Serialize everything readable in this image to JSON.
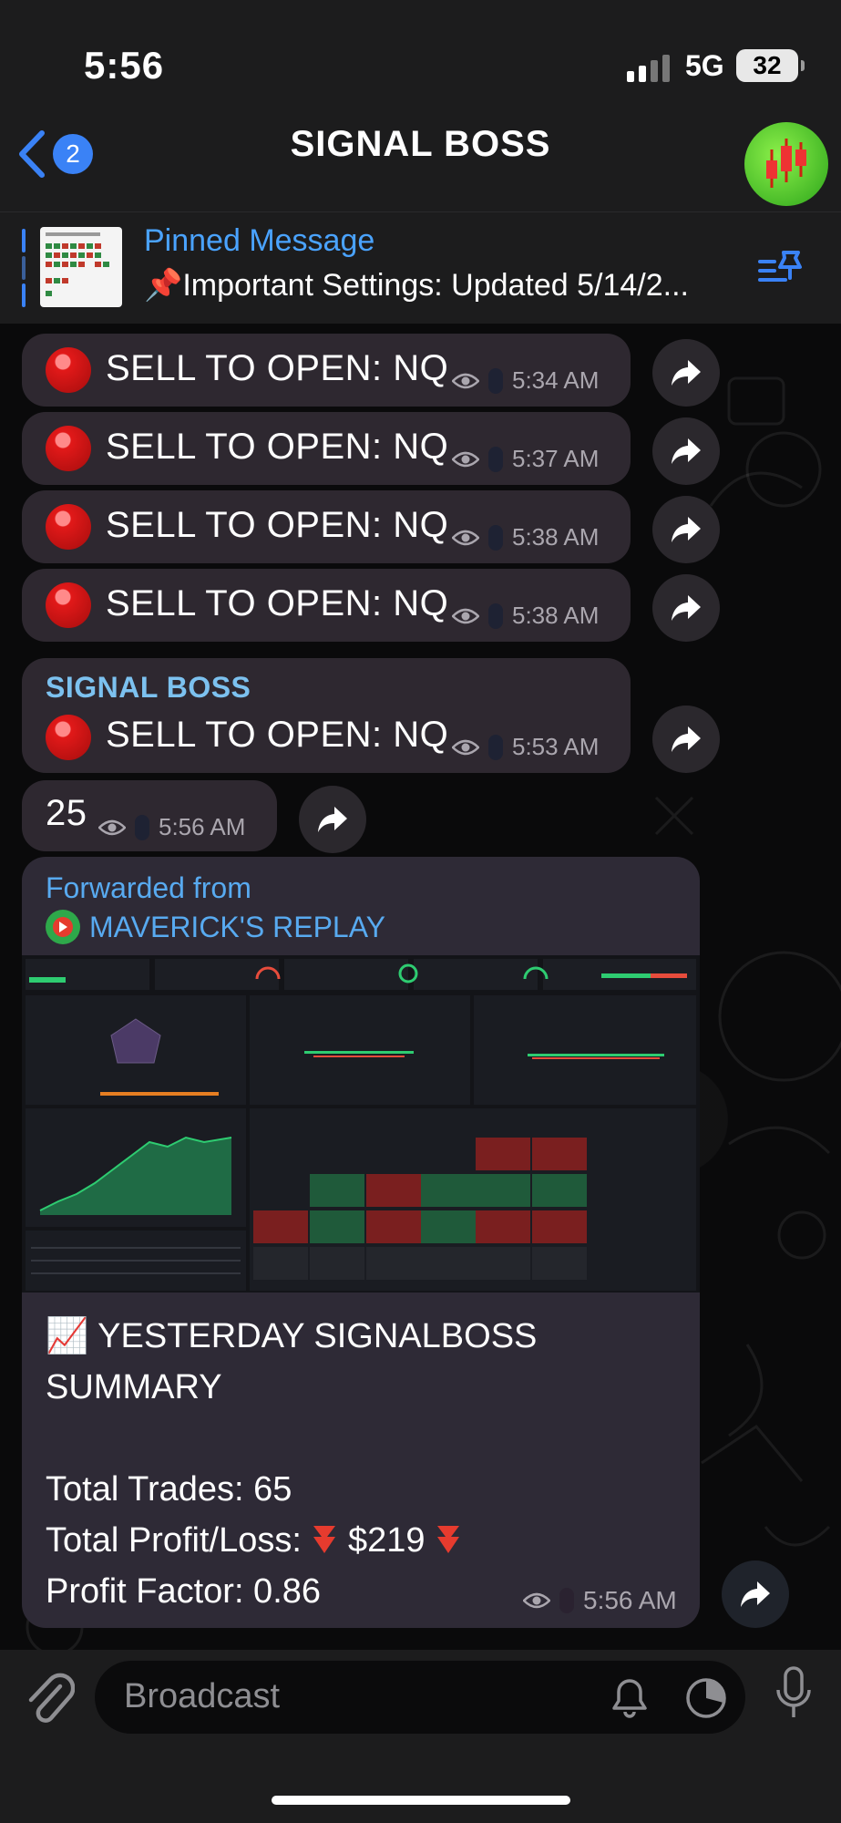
{
  "status": {
    "time": "5:56",
    "network": "5G",
    "battery": "32"
  },
  "header": {
    "back_count": "2",
    "title": "SIGNAL BOSS"
  },
  "pinned": {
    "label": "Pinned Message",
    "text": "📌Important Settings: Updated 5/14/2..."
  },
  "messages": [
    {
      "text": "SELL TO OPEN: NQ",
      "time": "5:34 AM"
    },
    {
      "text": "SELL TO OPEN: NQ",
      "time": "5:37 AM"
    },
    {
      "text": "SELL TO OPEN: NQ",
      "time": "5:38 AM"
    },
    {
      "text": "SELL TO OPEN: NQ",
      "time": "5:38 AM"
    },
    {
      "sender": "SIGNAL BOSS",
      "text": "SELL TO OPEN: NQ",
      "time": "5:53 AM"
    },
    {
      "text": "25",
      "time": "5:56 AM"
    }
  ],
  "forwarded": {
    "label": "Forwarded from",
    "source": "MAVERICK'S REPLAY",
    "summary_title_1": "📈 YESTERDAY SIGNALBOSS",
    "summary_title_2": "SUMMARY",
    "total_trades": "Total Trades: 65",
    "profit_loss_label": "Total Profit/Loss:",
    "profit_loss_value": "$219",
    "profit_factor": "Profit Factor:  0.86",
    "time": "5:56 AM"
  },
  "composer": {
    "placeholder": "Broadcast"
  },
  "colors": {
    "accent": "#3a82f6",
    "link": "#58aaf0",
    "bubble": "#2e2830",
    "bar": "#1c1c1d"
  }
}
